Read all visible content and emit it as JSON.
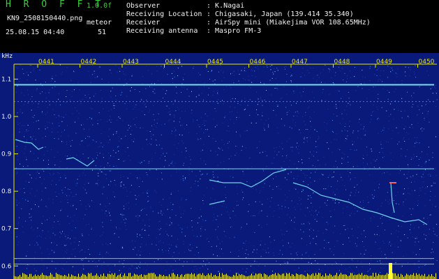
{
  "header": {
    "app_title": "H R O F F T",
    "version": "1.0.0f",
    "file_name": "KN9_2508150440.png",
    "mode_label": "meteor",
    "timestamp": "25.08.15 04:40",
    "count": "51"
  },
  "info": [
    {
      "label": "Observer",
      "value": ": K.Nagai"
    },
    {
      "label": "Receiving Location",
      "value": ": Chigasaki, Japan (139.414 35.340)"
    },
    {
      "label": "Receiver",
      "value": ": AirSpy mini (Miakejima VOR 108.65MHz)"
    },
    {
      "label": "Receiving antenna",
      "value": ": Maspro FM-3"
    }
  ],
  "spectrogram": {
    "y_unit": "kHz",
    "y_ticks": [
      "1.1",
      "1.0",
      "0.9",
      "0.8",
      "0.7",
      "0.6"
    ],
    "x_ticks": [
      "0441",
      "0442",
      "0443",
      "0444",
      "0445",
      "0446",
      "0447",
      "0448",
      "0449",
      "0450"
    ],
    "y_range_khz": [
      0.58,
      1.14
    ],
    "carrier_khz": [
      1.085,
      0.86,
      0.62,
      0.605
    ],
    "colors": {
      "background": "#0a1a7a",
      "noise_light": "#4a8cff",
      "signal": "#7ff5ff",
      "level": "#ffff33",
      "axis": "#e8e800"
    }
  }
}
